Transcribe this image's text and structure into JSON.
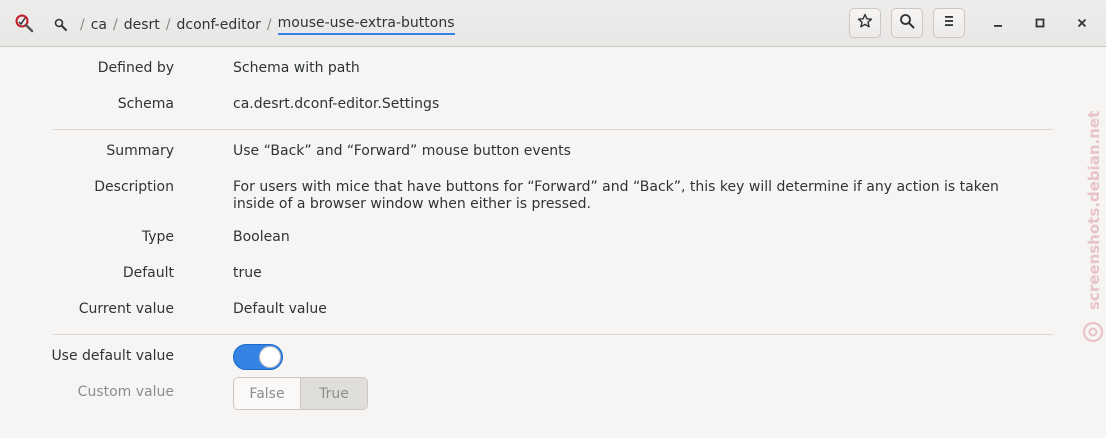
{
  "header": {
    "breadcrumbs": [
      "ca",
      "desrt",
      "dconf-editor"
    ],
    "current": "mouse-use-extra-buttons",
    "buttons": [
      "bookmark-icon",
      "search-icon",
      "menu-icon"
    ],
    "window_controls": [
      "minimize-icon",
      "maximize-icon",
      "close-icon"
    ]
  },
  "properties": [
    {
      "label": "Defined by",
      "value": "Schema with path"
    },
    {
      "label": "Schema",
      "value": "ca.desrt.dconf-editor.Settings"
    },
    {
      "label": "Summary",
      "value": "Use “Back” and “Forward” mouse button events"
    },
    {
      "label": "Description",
      "value": "For users with mice that have buttons for “Forward” and “Back”, this key will determine if any action is taken inside of a browser window when either is pressed."
    },
    {
      "label": "Type",
      "value": "Boolean"
    },
    {
      "label": "Default",
      "value": "true"
    },
    {
      "label": "Current value",
      "value": "Default value"
    }
  ],
  "controls": {
    "use_default_label": "Use default value",
    "use_default_on": true,
    "custom_value_label": "Custom value",
    "custom_options": [
      "False",
      "True"
    ],
    "custom_selected": "True"
  },
  "watermark": "screenshots.debian.net",
  "colors": {
    "accent": "#3584e4",
    "background": "#f6f5f4",
    "watermark": "#e8c3c8"
  }
}
